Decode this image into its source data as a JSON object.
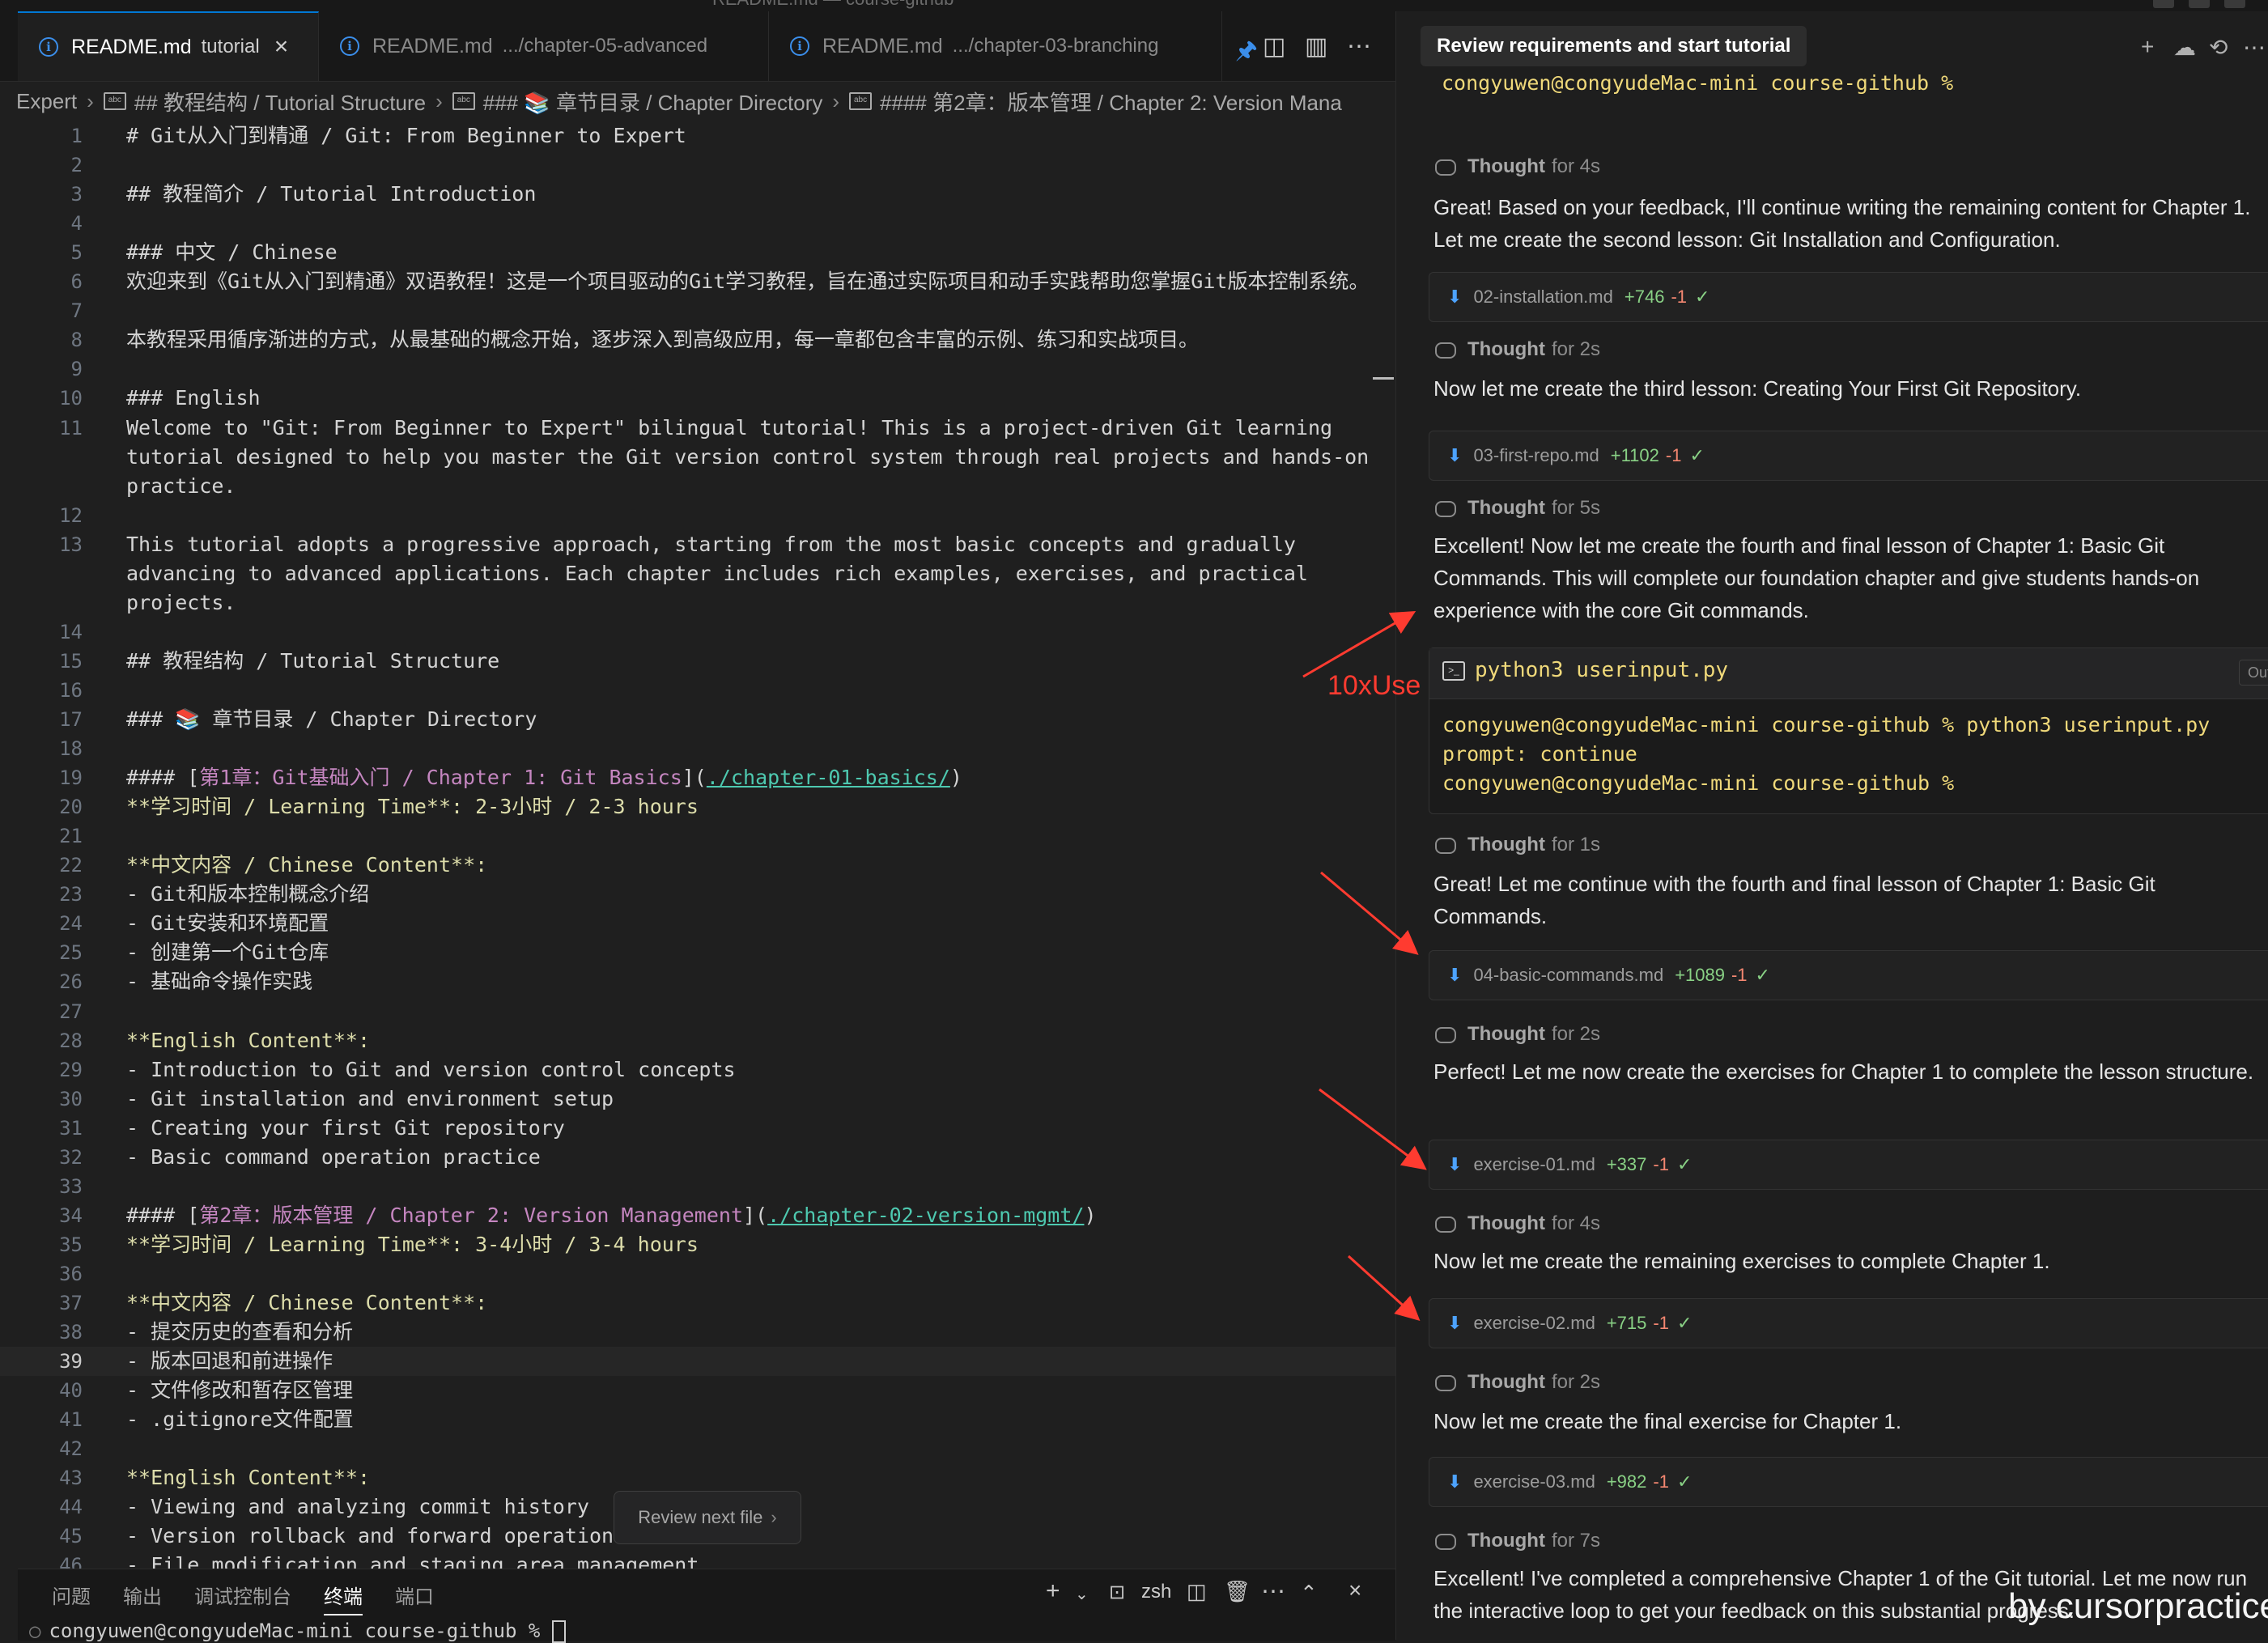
{
  "window": {
    "title": "README.md — course-github"
  },
  "tabs": [
    {
      "label": "README.md",
      "desc": "tutorial",
      "active": true
    },
    {
      "label": "README.md",
      "desc": ".../chapter-05-advanced",
      "active": false
    },
    {
      "label": "README.md",
      "desc": ".../chapter-03-branching",
      "active": false
    }
  ],
  "breadcrumb": [
    "Expert",
    "## 教程结构 / Tutorial Structure",
    "### 📚 章节目录 / Chapter Directory",
    "#### 第2章：版本管理 / Chapter 2: Version Mana"
  ],
  "editor": {
    "current_line": 39,
    "review_button": "Review next file",
    "lines": [
      {
        "n": "1",
        "t": "# Git从入门到精通 / Git: From Beginner to Expert"
      },
      {
        "n": "2",
        "t": ""
      },
      {
        "n": "3",
        "t": "## 教程简介 / Tutorial Introduction"
      },
      {
        "n": "4",
        "t": ""
      },
      {
        "n": "5",
        "t": "### 中文 / Chinese"
      },
      {
        "n": "6",
        "t": "欢迎来到《Git从入门到精通》双语教程！这是一个项目驱动的Git学习教程，旨在通过实际项目和动手实践帮助您掌握Git版本控制系统。"
      },
      {
        "n": "7",
        "t": ""
      },
      {
        "n": "8",
        "t": "本教程采用循序渐进的方式，从最基础的概念开始，逐步深入到高级应用，每一章都包含丰富的示例、练习和实战项目。"
      },
      {
        "n": "9",
        "t": ""
      },
      {
        "n": "10",
        "t": "### English"
      },
      {
        "n": "11",
        "t": "Welcome to \"Git: From Beginner to Expert\" bilingual tutorial! This is a project-driven Git learning"
      },
      {
        "n": "",
        "t": "tutorial designed to help you master the Git version control system through real projects and hands-on"
      },
      {
        "n": "",
        "t": "practice."
      },
      {
        "n": "12",
        "t": ""
      },
      {
        "n": "13",
        "t": "This tutorial adopts a progressive approach, starting from the most basic concepts and gradually"
      },
      {
        "n": "",
        "t": "advancing to advanced applications. Each chapter includes rich examples, exercises, and practical"
      },
      {
        "n": "",
        "t": "projects."
      },
      {
        "n": "14",
        "t": ""
      },
      {
        "n": "15",
        "t": "## 教程结构 / Tutorial Structure"
      },
      {
        "n": "16",
        "t": ""
      },
      {
        "n": "17",
        "t": "### 📚 章节目录 / Chapter Directory"
      },
      {
        "n": "18",
        "t": ""
      },
      {
        "n": "19",
        "t": "#### [第1章：Git基础入门 / Chapter 1: Git Basics](./chapter-01-basics/)"
      },
      {
        "n": "20",
        "t": "**学习时间 / Learning Time**: 2-3小时 / 2-3 hours"
      },
      {
        "n": "21",
        "t": ""
      },
      {
        "n": "22",
        "t": "**中文内容 / Chinese Content**:"
      },
      {
        "n": "23",
        "t": "- Git和版本控制概念介绍"
      },
      {
        "n": "24",
        "t": "- Git安装和环境配置"
      },
      {
        "n": "25",
        "t": "- 创建第一个Git仓库"
      },
      {
        "n": "26",
        "t": "- 基础命令操作实践"
      },
      {
        "n": "27",
        "t": ""
      },
      {
        "n": "28",
        "t": "**English Content**:"
      },
      {
        "n": "29",
        "t": "- Introduction to Git and version control concepts"
      },
      {
        "n": "30",
        "t": "- Git installation and environment setup"
      },
      {
        "n": "31",
        "t": "- Creating your first Git repository"
      },
      {
        "n": "32",
        "t": "- Basic command operation practice"
      },
      {
        "n": "33",
        "t": ""
      },
      {
        "n": "34",
        "t": "#### [第2章：版本管理 / Chapter 2: Version Management](./chapter-02-version-mgmt/)"
      },
      {
        "n": "35",
        "t": "**学习时间 / Learning Time**: 3-4小时 / 3-4 hours"
      },
      {
        "n": "36",
        "t": ""
      },
      {
        "n": "37",
        "t": "**中文内容 / Chinese Content**:"
      },
      {
        "n": "38",
        "t": "- 提交历史的查看和分析"
      },
      {
        "n": "39",
        "t": "- 版本回退和前进操作"
      },
      {
        "n": "40",
        "t": "- 文件修改和暂存区管理"
      },
      {
        "n": "41",
        "t": "- .gitignore文件配置"
      },
      {
        "n": "42",
        "t": ""
      },
      {
        "n": "43",
        "t": "**English Content**:"
      },
      {
        "n": "44",
        "t": "- Viewing and analyzing commit history"
      },
      {
        "n": "45",
        "t": "- Version rollback and forward operations"
      },
      {
        "n": "46",
        "t": "- File modification and staging area management"
      }
    ]
  },
  "panel": {
    "tabs": [
      "问题",
      "输出",
      "调试控制台",
      "终端",
      "端口"
    ],
    "active_tab": "终端",
    "shell": "zsh",
    "prompt": "congyuwen@congyudeMac-mini course-github % "
  },
  "chat": {
    "title": "Review requirements and start tutorial",
    "top_prompt": "congyuwen@congyudeMac-mini course-github %",
    "items": [
      {
        "kind": "thought",
        "label": "Thought",
        "dur": "for 4s"
      },
      {
        "kind": "msg",
        "text": "Great! Based on your feedback, I'll continue writing the remaining content for Chapter 1. Let me create the second lesson: Git Installation and Configuration."
      },
      {
        "kind": "file",
        "name": "02-installation.md",
        "add": "+746",
        "del": "-1"
      },
      {
        "kind": "thought",
        "label": "Thought",
        "dur": "for 2s"
      },
      {
        "kind": "msg",
        "text": "Now let me create the third lesson: Creating Your First Git Repository."
      },
      {
        "kind": "file",
        "name": "03-first-repo.md",
        "add": "+1102",
        "del": "-1"
      },
      {
        "kind": "thought",
        "label": "Thought",
        "dur": "for 5s"
      },
      {
        "kind": "msg",
        "text": "Excellent! Now let me create the fourth and final lesson of Chapter 1: Basic Git Commands. This will complete our foundation chapter and give students hands-on experience with the core Git commands."
      },
      {
        "kind": "thought",
        "label": "Thought",
        "dur": "for 1s"
      },
      {
        "kind": "msg",
        "text": "Great! Let me continue with the fourth and final lesson of Chapter 1: Basic Git Commands."
      },
      {
        "kind": "file",
        "name": "04-basic-commands.md",
        "add": "+1089",
        "del": "-1"
      },
      {
        "kind": "thought",
        "label": "Thought",
        "dur": "for 2s"
      },
      {
        "kind": "msg",
        "text": "Perfect! Let me now create the exercises for Chapter 1 to complete the lesson structure."
      },
      {
        "kind": "file",
        "name": "exercise-01.md",
        "add": "+337",
        "del": "-1"
      },
      {
        "kind": "thought",
        "label": "Thought",
        "dur": "for 4s"
      },
      {
        "kind": "msg",
        "text": "Now let me create the remaining exercises to complete Chapter 1."
      },
      {
        "kind": "file",
        "name": "exercise-02.md",
        "add": "+715",
        "del": "-1"
      },
      {
        "kind": "thought",
        "label": "Thought",
        "dur": "for 2s"
      },
      {
        "kind": "msg",
        "text": "Now let me create the final exercise for Chapter 1."
      },
      {
        "kind": "file",
        "name": "exercise-03.md",
        "add": "+982",
        "del": "-1"
      },
      {
        "kind": "thought",
        "label": "Thought",
        "dur": "for 7s"
      },
      {
        "kind": "msg",
        "text": "Excellent! I've completed a comprehensive Chapter 1 of the Git tutorial. Let me now run the interactive loop to get your feedback on this substantial progress."
      }
    ],
    "terminal": {
      "command": "python3 userinput.py",
      "output_label": "Output",
      "lines": [
        "congyuwen@congyudeMac-mini course-github % python3 userinput.py",
        "prompt: continue",
        "congyuwen@congyudeMac-mini course-github %"
      ]
    }
  },
  "annotation": {
    "label": "10xUse",
    "color": "#ff3b30"
  },
  "watermark": "by cursorpractice"
}
